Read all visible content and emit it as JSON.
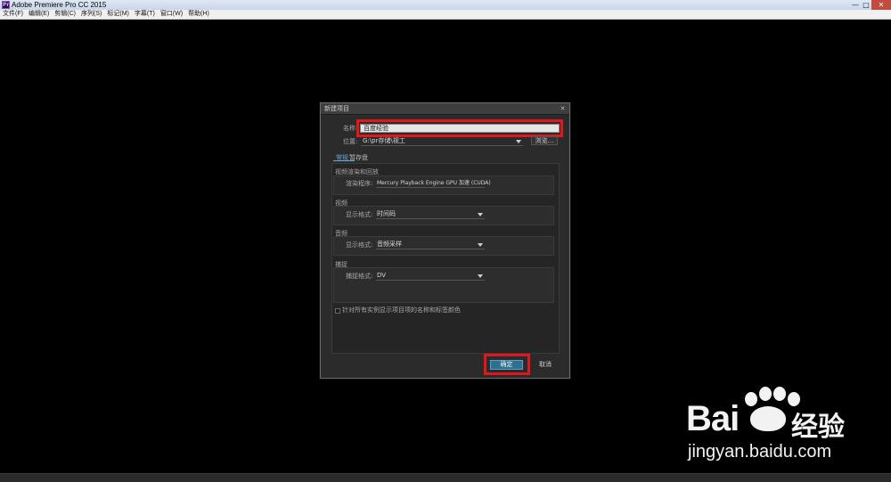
{
  "window": {
    "title": "Adobe Premiere Pro CC 2015",
    "app_icon_letters": "Pr",
    "minimize": "—",
    "maximize": "□",
    "close": "✕"
  },
  "menu": [
    "文件(F)",
    "编辑(E)",
    "剪辑(C)",
    "序列(S)",
    "标记(M)",
    "字幕(T)",
    "窗口(W)",
    "帮助(H)"
  ],
  "dialog": {
    "title": "新建项目",
    "close": "✕",
    "name_label": "名称:",
    "name_value": "百度经验",
    "location_label": "位置:",
    "location_value": "G:\\pr存储\\视工",
    "browse_label": "浏览...",
    "tabs": [
      {
        "label": "常规",
        "active": true
      },
      {
        "label": "暂存盘",
        "active": false
      }
    ],
    "sections": [
      {
        "title": "视频渲染和回放",
        "field_label": "渲染程序:",
        "field_value": "Mercury Playback Engine GPU 加速 (CUDA)"
      },
      {
        "title": "视频",
        "field_label": "显示格式:",
        "field_value": "时间码"
      },
      {
        "title": "音频",
        "field_label": "显示格式:",
        "field_value": "音频采样"
      },
      {
        "title": "捕捉",
        "field_label": "捕捉格式:",
        "field_value": "DV"
      }
    ],
    "checkbox_label": "针对所有实例显示项目项的名称和标签颜色",
    "checkbox_checked": false,
    "ok_label": "确定",
    "cancel_label": "取消"
  },
  "watermark": {
    "brand_text": "Bai",
    "brand_suffix": "经验",
    "url": "jingyan.baidu.com"
  },
  "colors": {
    "highlight": "#e3161b",
    "accent": "#6fa8dc",
    "ok_button": "#2f6f8f"
  }
}
